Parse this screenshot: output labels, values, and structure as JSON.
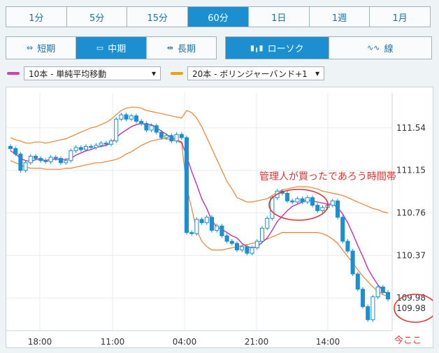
{
  "timeframes": [
    {
      "label": "1分",
      "active": false
    },
    {
      "label": "5分",
      "active": false
    },
    {
      "label": "15分",
      "active": false
    },
    {
      "label": "60分",
      "active": true
    },
    {
      "label": "1日",
      "active": false
    },
    {
      "label": "1週",
      "active": false
    },
    {
      "label": "1月",
      "active": false
    }
  ],
  "terms": [
    {
      "label": "短期",
      "icon": "⇔",
      "active": false
    },
    {
      "label": "中期",
      "icon": "▭",
      "active": true
    },
    {
      "label": "長期",
      "icon": "⇹",
      "active": false
    }
  ],
  "chart_types": [
    {
      "label": "ローソク",
      "icon": "▮╻▮",
      "active": true
    },
    {
      "label": "線",
      "icon": "∿∿",
      "active": false
    }
  ],
  "indicators": {
    "sma": {
      "label": "10本 - 単純平均移動",
      "color": "#d040a8"
    },
    "bollinger": {
      "label": "20本 - ボリンジャーバンド+1",
      "color": "#f0a000"
    }
  },
  "colors": {
    "candle": "#1b8fd0",
    "sma": "#c62fb0",
    "band": "#f08030",
    "annotation": "#e53030"
  },
  "annotations": {
    "admin_note": "管理人が買ったであろう時間帯",
    "now_note": "今ここ"
  },
  "chart_data": {
    "type": "candlestick",
    "x_labels": [
      "18:00",
      "11:00",
      "04:00",
      "21:00",
      "14:00"
    ],
    "y_ticks": [
      111.54,
      111.15,
      110.76,
      110.37,
      109.98
    ],
    "ylim": [
      109.68,
      111.86
    ],
    "current_price": "109.98",
    "close": [
      111.35,
      111.3,
      111.15,
      111.22,
      111.28,
      111.26,
      111.24,
      111.23,
      111.27,
      111.26,
      111.22,
      111.24,
      111.33,
      111.36,
      111.34,
      111.37,
      111.36,
      111.38,
      111.4,
      111.39,
      111.42,
      111.62,
      111.66,
      111.62,
      111.65,
      111.6,
      111.58,
      111.52,
      111.56,
      111.5,
      111.45,
      111.47,
      111.42,
      111.48,
      111.45,
      110.58,
      110.57,
      110.7,
      110.67,
      110.72,
      110.6,
      110.64,
      110.55,
      110.5,
      110.48,
      110.42,
      110.45,
      110.39,
      110.44,
      110.5,
      110.62,
      110.71,
      110.9,
      110.96,
      110.94,
      110.87,
      110.86,
      110.89,
      110.86,
      110.9,
      110.83,
      110.78,
      110.81,
      110.83,
      110.87,
      110.72,
      110.5,
      110.41,
      110.2,
      110.06,
      109.9,
      109.78,
      109.99,
      110.08,
      110.03,
      109.97
    ],
    "sma": [
      111.33,
      111.3,
      111.26,
      111.24,
      111.23,
      111.25,
      111.25,
      111.24,
      111.25,
      111.25,
      111.25,
      111.25,
      111.26,
      111.29,
      111.31,
      111.33,
      111.34,
      111.36,
      111.37,
      111.38,
      111.4,
      111.45,
      111.49,
      111.52,
      111.55,
      111.57,
      111.58,
      111.57,
      111.57,
      111.54,
      111.51,
      111.48,
      111.45,
      111.43,
      111.41,
      111.28,
      111.14,
      111.02,
      110.89,
      110.8,
      110.69,
      110.63,
      110.61,
      110.58,
      110.55,
      110.53,
      110.48,
      110.45,
      110.44,
      110.45,
      110.49,
      110.53,
      110.6,
      110.68,
      110.73,
      110.78,
      110.82,
      110.84,
      110.86,
      110.88,
      110.87,
      110.86,
      110.85,
      110.84,
      110.84,
      110.81,
      110.75,
      110.67,
      110.57,
      110.46,
      110.36,
      110.25,
      110.17,
      110.1,
      110.05,
      110.01
    ],
    "upper_band": [
      111.45,
      111.43,
      111.42,
      111.4,
      111.4,
      111.41,
      111.41,
      111.4,
      111.41,
      111.42,
      111.43,
      111.44,
      111.46,
      111.48,
      111.5,
      111.52,
      111.54,
      111.55,
      111.57,
      111.59,
      111.62,
      111.66,
      111.7,
      111.72,
      111.73,
      111.73,
      111.72,
      111.7,
      111.69,
      111.68,
      111.67,
      111.66,
      111.65,
      111.64,
      111.63,
      111.7,
      111.68,
      111.63,
      111.55,
      111.45,
      111.35,
      111.25,
      111.15,
      111.05,
      110.98,
      110.9,
      110.88,
      110.86,
      110.86,
      110.87,
      110.88,
      110.89,
      110.92,
      110.95,
      110.97,
      110.98,
      110.99,
      111,
      111,
      111,
      110.99,
      110.98,
      110.96,
      110.95,
      110.94,
      110.93,
      110.92,
      110.9,
      110.88,
      110.86,
      110.84,
      110.82,
      110.8,
      110.79,
      110.77,
      110.76
    ],
    "lower_band": [
      111.24,
      111.22,
      111.2,
      111.18,
      111.17,
      111.17,
      111.17,
      111.16,
      111.16,
      111.16,
      111.16,
      111.17,
      111.17,
      111.18,
      111.19,
      111.2,
      111.21,
      111.22,
      111.22,
      111.23,
      111.24,
      111.25,
      111.27,
      111.3,
      111.32,
      111.35,
      111.38,
      111.4,
      111.42,
      111.43,
      111.44,
      111.44,
      111.43,
      111.42,
      111.4,
      111.0,
      110.8,
      110.6,
      110.5,
      110.45,
      110.42,
      110.42,
      110.42,
      110.43,
      110.44,
      110.45,
      110.46,
      110.47,
      110.48,
      110.49,
      110.5,
      110.52,
      110.54,
      110.56,
      110.58,
      110.58,
      110.58,
      110.58,
      110.58,
      110.58,
      110.58,
      110.58,
      110.57,
      110.55,
      110.52,
      110.48,
      110.42,
      110.36,
      110.3,
      110.24,
      110.18,
      110.13,
      110.08,
      110.04,
      110.01,
      109.99
    ]
  }
}
